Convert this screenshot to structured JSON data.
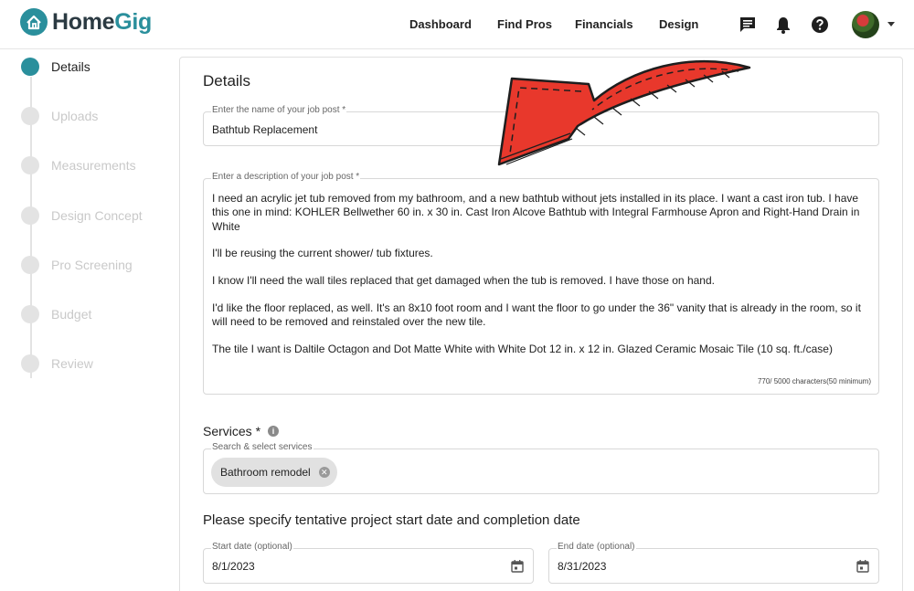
{
  "header": {
    "logo_part1": "Home",
    "logo_part2": "Gig",
    "nav": [
      "Dashboard",
      "Find Pros",
      "Financials",
      "Design"
    ]
  },
  "stepper": {
    "steps": [
      "Details",
      "Uploads",
      "Measurements",
      "Design Concept",
      "Pro Screening",
      "Budget",
      "Review"
    ],
    "active": "Details"
  },
  "form": {
    "title": "Details",
    "job_name": {
      "label": "Enter the name of your job post *",
      "value": "Bathtub Replacement"
    },
    "description": {
      "label": "Enter a description of your job post *",
      "paragraphs": [
        "I need an acrylic jet tub removed from my bathroom, and a new bathtub without jets installed in its place. I want a cast iron tub. I have this one in mind: KOHLER Bellwether 60 in. x 30 in.  Cast Iron Alcove Bathtub with Integral Farmhouse Apron and Right-Hand Drain in White",
        "I'll be reusing the current shower/ tub fixtures.",
        "I know I'll need the wall tiles replaced that get damaged when the tub is removed. I have those on hand.",
        "I'd like the floor replaced, as well. It's an 8x10 foot room and I want the floor to go under the 36\" vanity that is already in the room, so it will need to be removed and reinstaled over the new tile.",
        "The tile I want is Daltile Octagon and Dot Matte White with White Dot 12 in. x 12 in. Glazed Ceramic Mosaic Tile (10 sq. ft./case)"
      ],
      "char_count": "770/ 5000  characters(50 minimum)"
    },
    "services": {
      "label": "Services *",
      "info": "i",
      "search_label": "Search & select services",
      "chips": [
        "Bathroom remodel"
      ]
    },
    "dates_heading": "Please specify tentative project start date and completion date",
    "start_date": {
      "label": "Start date (optional)",
      "value": "8/1/2023"
    },
    "end_date": {
      "label": "End date (optional)",
      "value": "8/31/2023"
    }
  },
  "colors": {
    "brand_teal": "#2a8f9c",
    "arrow_red": "#e8382c"
  },
  "icons": [
    "house-logo-icon",
    "chat-icon",
    "bell-icon",
    "help-icon",
    "calendar-icon",
    "close-icon",
    "info-icon",
    "chevron-down-icon"
  ]
}
